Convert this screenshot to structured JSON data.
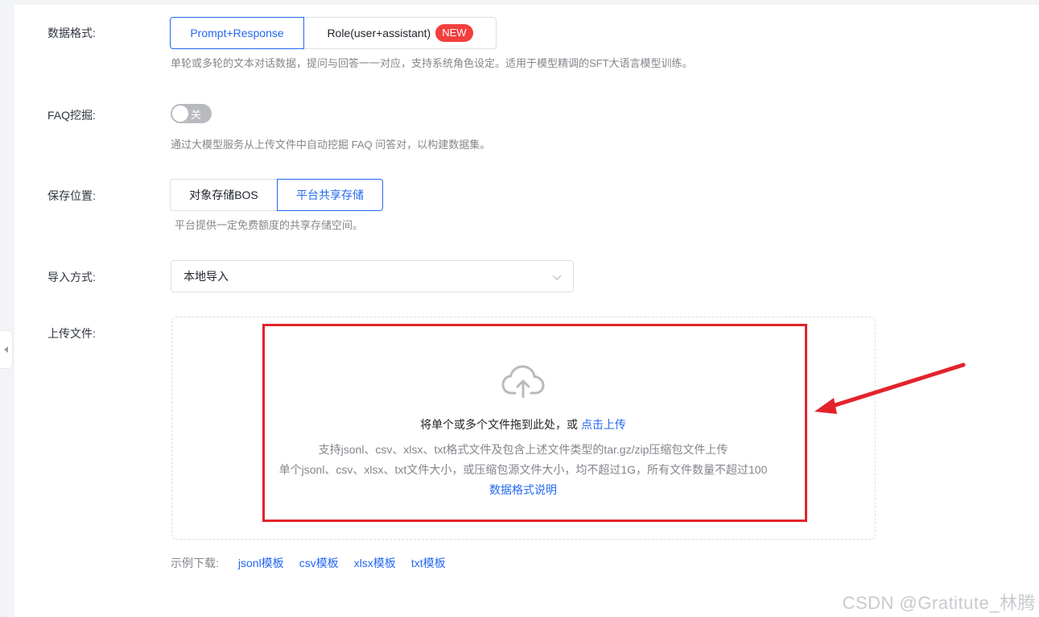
{
  "form": {
    "data_format": {
      "label": "数据格式:",
      "options": [
        {
          "label": "Prompt+Response",
          "active": true
        },
        {
          "label": "Role(user+assistant)",
          "badge": "NEW",
          "active": false
        }
      ],
      "hint": "单轮或多轮的文本对话数据，提问与回答一一对应，支持系统角色设定。适用于模型精调的SFT大语言模型训练。"
    },
    "faq_mining": {
      "label": "FAQ挖掘:",
      "switch_text": "关",
      "switch_on": false,
      "hint": "通过大模型服务从上传文件中自动挖掘 FAQ 问答对，以构建数据集。"
    },
    "storage": {
      "label": "保存位置:",
      "options": [
        {
          "label": "对象存储BOS",
          "active": false
        },
        {
          "label": "平台共享存储",
          "active": true
        }
      ],
      "hint": "平台提供一定免费额度的共享存储空间。"
    },
    "import_method": {
      "label": "导入方式:",
      "selected": "本地导入"
    },
    "upload": {
      "label": "上传文件:",
      "main_text": "将单个或多个文件拖到此处，或",
      "main_link": "点击上传",
      "line1": "支持jsonl、csv、xlsx、txt格式文件及包含上述文件类型的tar.gz/zip压缩包文件上传",
      "line2": "单个jsonl、csv、xlsx、txt文件大小，或压缩包源文件大小，均不超过1G，所有文件数量不超过100",
      "format_link": "数据格式说明"
    },
    "examples": {
      "label": "示例下载:",
      "links": [
        "jsonl模板",
        "csv模板",
        "xlsx模板",
        "txt模板"
      ]
    }
  },
  "watermark": "CSDN @Gratitute_林腾",
  "colors": {
    "accent": "#2468f2",
    "annotation_red": "#e3232c",
    "badge_red": "#f33e3e"
  }
}
